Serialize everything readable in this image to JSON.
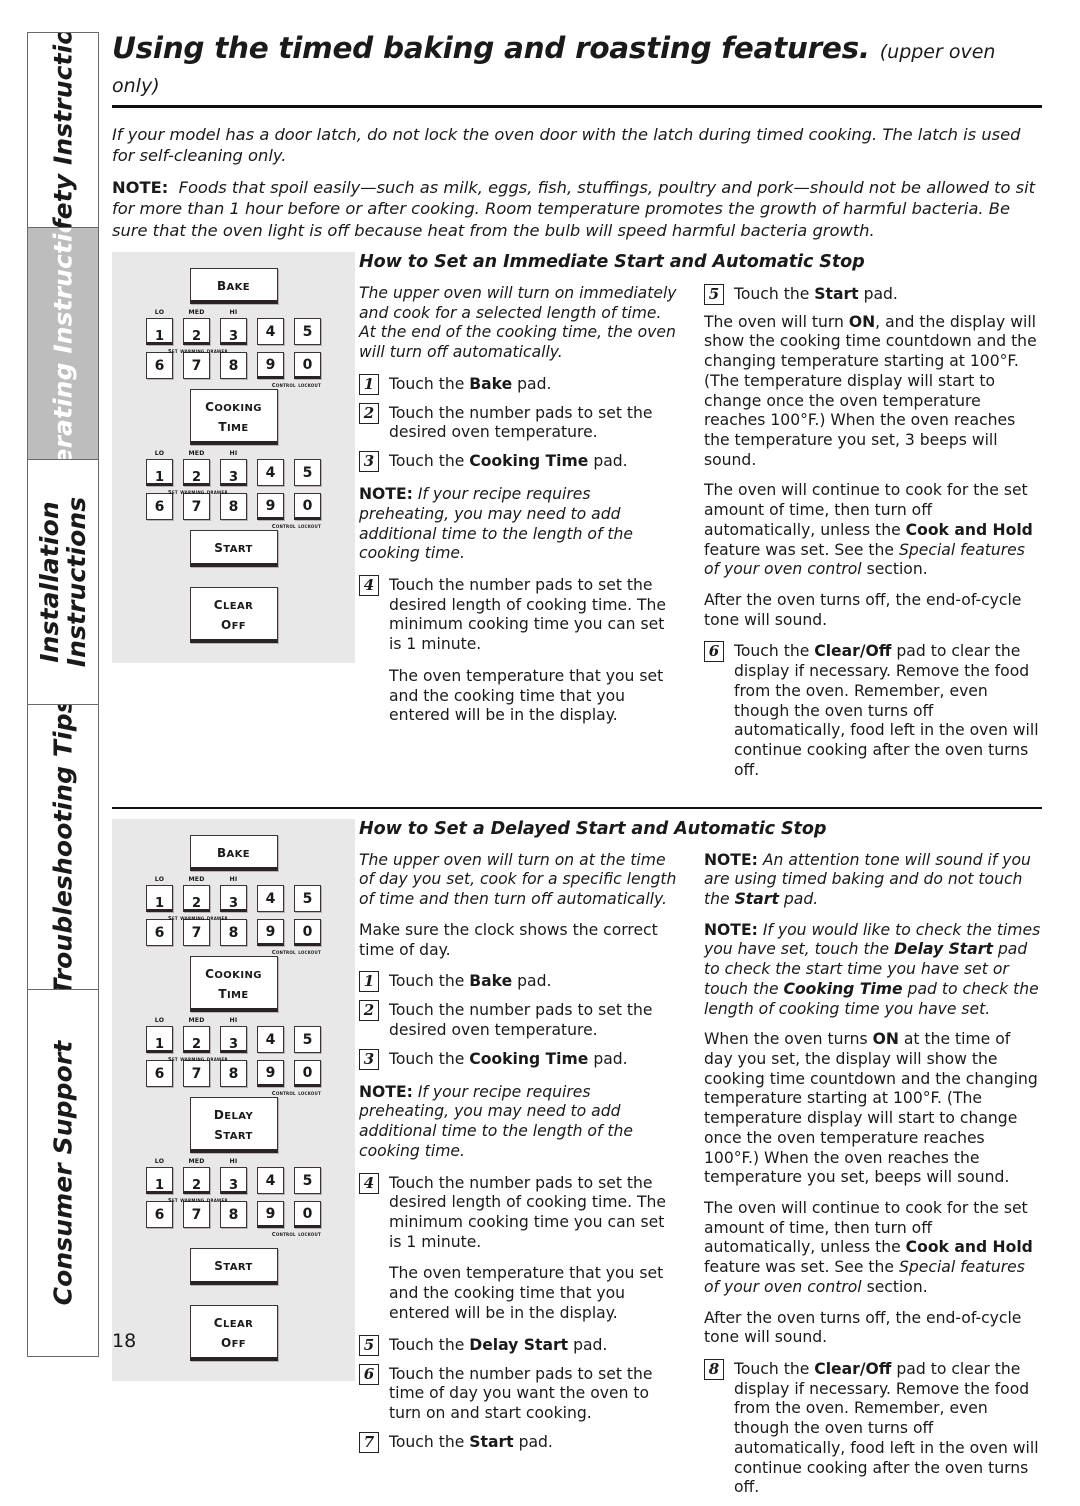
{
  "sidebar": {
    "tabs": [
      {
        "label": "Safety Instructions",
        "active": false
      },
      {
        "label": "Operating Instructions",
        "active": true
      },
      {
        "label": "Installation\nInstructions",
        "active": false
      },
      {
        "label": "Troubleshooting Tips",
        "active": false
      },
      {
        "label": "Consumer Support",
        "active": false
      }
    ],
    "active_bg": "#bdbdbd"
  },
  "page": {
    "number": "18",
    "title": "Using the timed baking and roasting features.",
    "title_sub": "(upper oven only)",
    "intro1": "If your model has a door latch, do not lock the oven door with the latch during timed cooking. The latch is used for self-cleaning only.",
    "intro2_label": "NOTE:",
    "intro2": "Foods that spoil easily—such as milk, eggs, fish, stuffings, poultry and pork—should not be allowed to sit for more than 1 hour before or after cooking. Room temperature promotes the growth of harmful bacteria. Be sure that the oven light is off because heat from the bulb will speed harmful bacteria growth."
  },
  "keypad": {
    "bake_label": "Bake",
    "cooking_time_line1": "Cooking",
    "cooking_time_line2": "Time",
    "delay_start_line1": "Delay",
    "delay_start_line2": "Start",
    "start_label": "Start",
    "clear_line1": "Clear",
    "clear_line2": "Off",
    "row1": [
      "1",
      "2",
      "3",
      "4",
      "5"
    ],
    "row2": [
      "6",
      "7",
      "8",
      "9",
      "0"
    ],
    "over1": "LO",
    "over2": "MED",
    "over3": "HI",
    "caption_warming": "Set Warming Drawer",
    "caption_lockout": "Control Lockout",
    "panel_bg": "#e8e8e8"
  },
  "section1": {
    "heading": "How to Set an Immediate Start and Automatic Stop",
    "mid": {
      "intro": "The upper oven will turn on immediately and cook for a selected length of time. At the end of the cooking time, the oven will turn off automatically.",
      "step1_num": "1",
      "step1": "Touch the Bake pad.",
      "step1_pre": "Touch the ",
      "step1_bold": "Bake",
      "step1_post": " pad.",
      "step2_num": "2",
      "step2": "Touch the number pads to set the desired oven temperature.",
      "step3_num": "3",
      "step3_pre": "Touch the ",
      "step3_bold": "Cooking Time",
      "step3_post": " pad.",
      "note_label": "NOTE:",
      "note": "If your recipe requires preheating, you may need to add additional time to the length of the cooking time.",
      "step4_num": "4",
      "step4": "Touch the number pads to set the desired length of cooking time. The minimum cooking time you can set is 1 minute.",
      "para_after4": "The oven temperature that you set and the cooking time that you entered will be in the display."
    },
    "right": {
      "step5_num": "5",
      "step5_pre": "Touch the ",
      "step5_bold": "Start",
      "step5_post": " pad.",
      "p1_a": "The oven will turn ",
      "p1_b": "ON",
      "p1_c": ", and the display will show the cooking time countdown and the changing temperature starting at 100°F. (The temperature display will start to change once the oven temperature reaches 100°F.) When the oven reaches the temperature you set, 3 beeps will sound.",
      "p2_a": "The oven will continue to cook for the set amount of time, then turn off automatically, unless the ",
      "p2_b": "Cook and Hold",
      "p2_c": " feature was set. See the ",
      "p2_d": "Special features of your oven control",
      "p2_e": " section.",
      "p3": "After the oven turns off, the end-of-cycle tone will sound.",
      "step6_num": "6",
      "step6_pre": "Touch the ",
      "step6_bold": "Clear/Off",
      "step6_post": " pad to clear the display if necessary. Remove the food from the oven. Remember, even though the oven turns off automatically, food left in the oven will continue cooking after the oven turns off."
    }
  },
  "section2": {
    "heading": "How to Set a Delayed Start and Automatic Stop",
    "mid": {
      "intro": "The upper oven will turn on at the time of day you set, cook for a specific length of time and then turn off automatically.",
      "clock_note": "Make sure the clock shows the correct time of day.",
      "step1_num": "1",
      "step1_pre": "Touch the ",
      "step1_bold": "Bake",
      "step1_post": " pad.",
      "step2_num": "2",
      "step2": "Touch the number pads to set the desired oven temperature.",
      "step3_num": "3",
      "step3_pre": "Touch the ",
      "step3_bold": "Cooking Time",
      "step3_post": " pad.",
      "note_label": "NOTE:",
      "note": "If your recipe requires preheating, you may need to add additional time to the length of the cooking time.",
      "step4_num": "4",
      "step4": "Touch the number pads to set the desired length of cooking time. The minimum cooking time you can set is 1 minute.",
      "para_after4": "The oven temperature that you set and the cooking time that you entered will be in the display.",
      "step5_num": "5",
      "step5_pre": "Touch the ",
      "step5_bold": "Delay Start",
      "step5_post": " pad.",
      "step6_num": "6",
      "step6": "Touch the number pads to set the time of day you want the oven to turn on and start cooking.",
      "step7_num": "7",
      "step7_pre": "Touch the ",
      "step7_bold": "Start",
      "step7_post": " pad."
    },
    "right": {
      "note1_label": "NOTE:",
      "note1_a": "An attention tone will sound if you are using timed baking and do not touch the ",
      "note1_b": "Start",
      "note1_c": " pad.",
      "note2_label": "NOTE:",
      "note2_a": "If you would like to check the times you have set, touch the ",
      "note2_b": "Delay Start",
      "note2_c": " pad to check the start time you have set or touch the ",
      "note2_d": "Cooking Time",
      "note2_e": " pad to check the length of cooking time you have set.",
      "p1_a": "When the oven turns ",
      "p1_b": "ON",
      "p1_c": " at the time of day you set, the display will show the cooking time countdown and the changing temperature starting at 100°F. (The temperature display will start to change once the oven temperature reaches 100°F.) When the oven reaches the temperature you set, beeps will sound.",
      "p2_a": "The oven will continue to cook for the set amount of time, then turn off automatically, unless the ",
      "p2_b": "Cook and Hold",
      "p2_c": " feature was set. See the ",
      "p2_d": "Special features of your oven control",
      "p2_e": " section.",
      "p3": "After the oven turns off, the end-of-cycle tone will sound.",
      "step8_num": "8",
      "step8_pre": "Touch the ",
      "step8_bold": "Clear/Off",
      "step8_post": " pad to clear the display if necessary. Remove the food from the oven. Remember, even though the oven turns off automatically, food left in the oven will continue cooking after the oven turns off."
    }
  }
}
